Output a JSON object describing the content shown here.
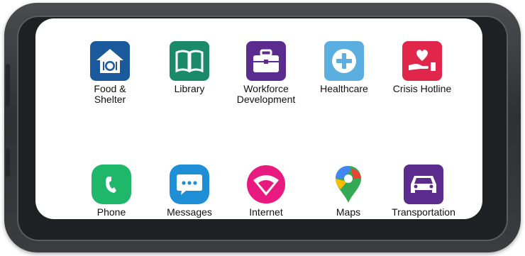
{
  "home_screen": {
    "apps": [
      {
        "label": "Food &\nShelter",
        "icon": "house-plate-icon",
        "color": "#1a5a9c"
      },
      {
        "label": "Library",
        "icon": "book-icon",
        "color": "#1b8a6b"
      },
      {
        "label": "Workforce\nDevelopment",
        "icon": "briefcase-icon",
        "color": "#5b2c8e"
      },
      {
        "label": "Healthcare",
        "icon": "plus-icon",
        "color": "#5aaee0"
      },
      {
        "label": "Crisis Hotline",
        "icon": "heart-hand-icon",
        "color": "#e0264a"
      },
      {
        "label": "Phone",
        "icon": "phone-icon",
        "color": "#1fb86a"
      },
      {
        "label": "Messages",
        "icon": "chat-bubble-icon",
        "color": "#1e8fd6"
      },
      {
        "label": "Internet",
        "icon": "wifi-icon",
        "color": "#e8197f"
      },
      {
        "label": "Maps",
        "icon": "map-pin-icon",
        "color": "#34a853"
      },
      {
        "label": "Transportation",
        "icon": "car-icon",
        "color": "#5b2c8e"
      }
    ]
  }
}
